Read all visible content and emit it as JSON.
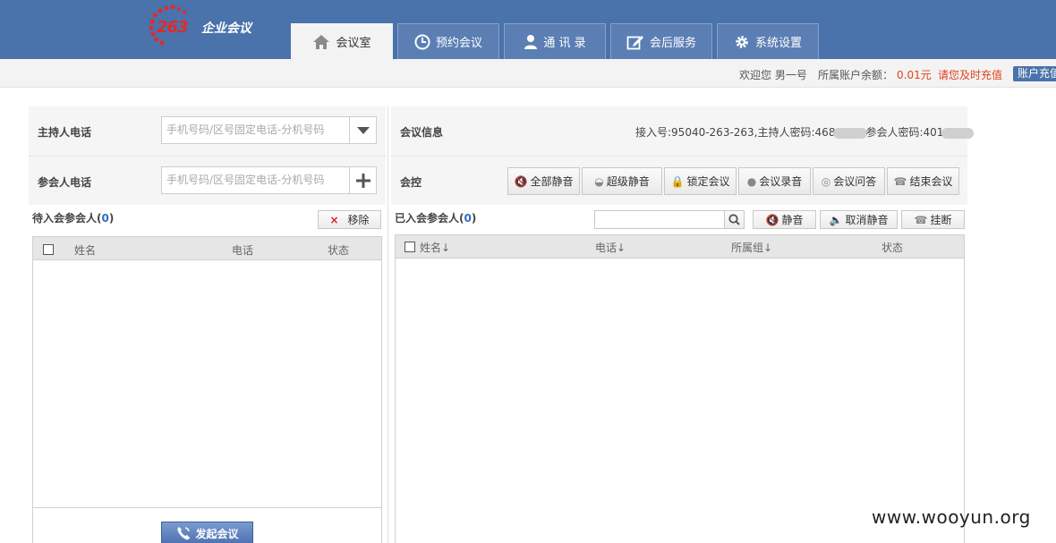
{
  "brand": {
    "logo_number": "263",
    "logo_text": "企业会议"
  },
  "nav": {
    "tabs": [
      {
        "label": "会议室",
        "icon": "home-icon",
        "active": true
      },
      {
        "label": "预约会议",
        "icon": "clock-icon",
        "active": false
      },
      {
        "label": "通 讯 录",
        "icon": "person-icon",
        "active": false
      },
      {
        "label": "会后服务",
        "icon": "edit-icon",
        "active": false
      },
      {
        "label": "系统设置",
        "icon": "gear-icon",
        "active": false
      }
    ]
  },
  "subbar": {
    "welcome": "欢迎您 男一号",
    "balance_label": "所属账户余额：",
    "balance_value": "0.01元",
    "recharge_hint": "请您及时充值",
    "recharge_button": "账户充值"
  },
  "left": {
    "host_label": "主持人电话",
    "host_placeholder": "手机号码/区号固定电话-分机号码",
    "participant_label": "参会人电话",
    "participant_placeholder": "手机号码/区号固定电话-分机号码",
    "pending_title": "待入会参会人",
    "pending_count": "0",
    "remove_button": "移除",
    "columns": [
      "姓名",
      "电话",
      "状态"
    ],
    "start_button": "发起会议"
  },
  "right": {
    "info_label": "会议信息",
    "info_prefix": "接入号:95040-263-263,主持人密码:468",
    "info_middle": "参会人密码:401",
    "control_label": "会控",
    "control_buttons": [
      "全部静音",
      "超级静音",
      "锁定会议",
      "会议录音",
      "会议问答",
      "结束会议"
    ],
    "joined_title": "已入会参会人",
    "joined_count": "0",
    "search_placeholder": "",
    "mute_button": "静音",
    "unmute_button": "取消静音",
    "hangup_button": "挂断",
    "columns": [
      "姓名↓",
      "电话↓",
      "所属组↓",
      "状态"
    ]
  },
  "watermark": "www.wooyun.org",
  "colors": {
    "header": "#4a72ab",
    "accent_red": "#e2401b",
    "count_blue": "#2f6fbf"
  }
}
